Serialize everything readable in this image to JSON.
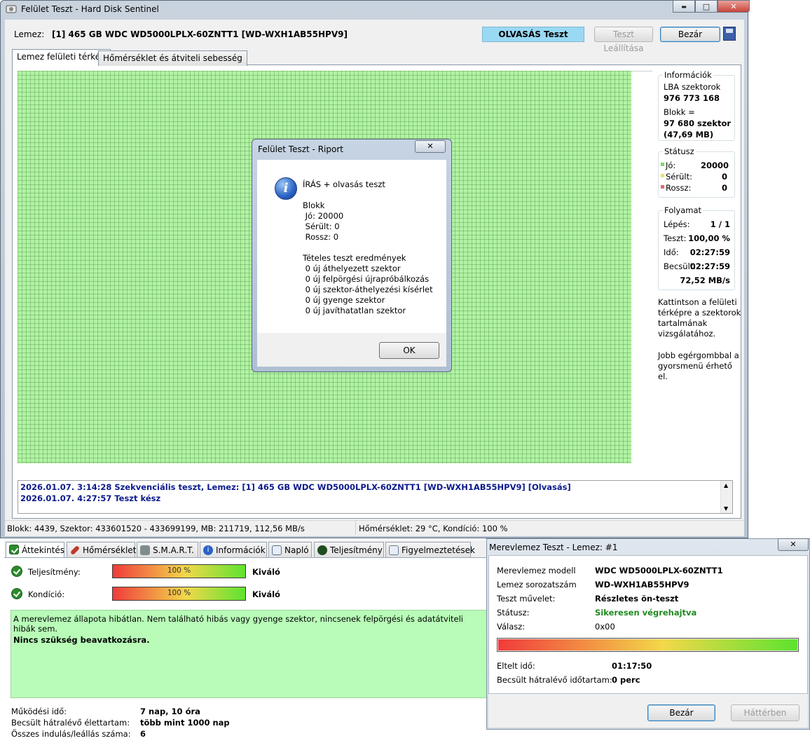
{
  "window": {
    "title": "Felület Teszt - Hard Disk Sentinel",
    "caption_minimize": "▬",
    "caption_maximize": "□",
    "caption_close": "✕"
  },
  "header": {
    "lemez_label": "Lemez:",
    "lemez_value": "[1] 465 GB  WDC WD5000LPLX-60ZNTT1 [WD-WXH1AB55HPV9]",
    "mode": "OLVASÁS Teszt",
    "stop_button": "Teszt Leállítása",
    "close_button": "Bezár"
  },
  "tabs": [
    {
      "label": "Lemez felületi térkép"
    },
    {
      "label": "Hőmérséklet és átviteli sebesség"
    }
  ],
  "info_box": {
    "title": "Információk",
    "lba_label": "LBA szektorok",
    "lba_value": "976 773 168",
    "block_label": "Blokk =",
    "block_value1": "97 680 szektor",
    "block_value2": "(47,69 MB)"
  },
  "status_box": {
    "title": "Státusz",
    "rows": [
      {
        "label": "Jó:",
        "value": "20000",
        "color": "#7fd86a"
      },
      {
        "label": "Sérült:",
        "value": "0",
        "color": "#e9e36a"
      },
      {
        "label": "Rossz:",
        "value": "0",
        "color": "#e36a6a"
      }
    ]
  },
  "progress_box": {
    "title": "Folyamat",
    "rows": [
      {
        "label": "Lépés:",
        "value": "1 / 1"
      },
      {
        "label": "Teszt:",
        "value": "100,00 %"
      },
      {
        "label": "Idő:",
        "value": "02:27:59"
      },
      {
        "label": "Becsült:",
        "value": "02:27:59"
      }
    ],
    "speed": "72,52 MB/s"
  },
  "hint1": [
    "Kattintson a felületi",
    "térképre a szektorok",
    "tartalmának",
    "vizsgálatához."
  ],
  "hint2": [
    "Jobb egérgombbal a",
    "gyorsmenü érhető",
    "el."
  ],
  "log": [
    "2026.01.07.  3:14:28   Szekvenciális teszt, Lemez: [1] 465 GB  WDC WD5000LPLX-60ZNTT1 [WD-WXH1AB55HPV9] [Olvasás]",
    "2026.01.07.  4:27:57   Teszt kész"
  ],
  "statusbar": {
    "left": "Blokk: 4439, Szektor: 433601520 - 433699199, MB: 211719, 112,56 MB/s",
    "right": "Hőmérséklet: 29  °C,  Kondíció: 100 %"
  },
  "report_dialog": {
    "title": "Felület Teszt - Riport",
    "close": "✕",
    "heading": "ÍRÁS + olvasás teszt",
    "block_title": "Blokk",
    "block_lines": [
      " Jó: 20000",
      " Sérült: 0",
      " Rossz: 0"
    ],
    "result_title": "Tételes teszt eredmények",
    "result_lines": [
      " 0 új áthelyezett szektor",
      " 0 új felpörgési újrapróbálkozás",
      " 0 új szektor-áthelyezési kísérlet",
      " 0 új gyenge szektor",
      " 0 új javíthatatlan szektor"
    ],
    "ok_button": "OK"
  },
  "overview": {
    "tabs": [
      {
        "label": "Áttekintés",
        "icon": "check-icon",
        "color": "#2d8a2d"
      },
      {
        "label": "Hőmérséklet",
        "icon": "thermometer-icon",
        "color": "#c0392b"
      },
      {
        "label": "S.M.A.R.T.",
        "icon": "chip-icon",
        "color": "#7f8c8d"
      },
      {
        "label": "Információk",
        "icon": "info-icon",
        "color": "#2a63c6"
      },
      {
        "label": "Napló",
        "icon": "document-icon",
        "color": "#5a6d8c"
      },
      {
        "label": "Teljesítmény",
        "icon": "gauge-icon",
        "color": "#1f4d1f"
      },
      {
        "label": "Figyelmeztetések",
        "icon": "alert-document-icon",
        "color": "#6b7a90"
      }
    ],
    "performance_label": "Teljesítmény:",
    "performance_percent": "100 %",
    "performance_value": 100,
    "performance_rating": "Kiváló",
    "condition_label": "Kondíció:",
    "condition_percent": "100 %",
    "condition_value": 100,
    "condition_rating": "Kiváló",
    "message": "A merevlemez állapota hibátlan. Nem található hibás vagy gyenge szektor, nincsenek felpörgési és adatátviteli hibák sem.",
    "message_bold": "Nincs szükség beavatkozásra.",
    "stats": [
      {
        "label": "Működési idő:",
        "value": "7 nap, 10 óra"
      },
      {
        "label": "Becsült hátralévő élettartam:",
        "value": "több mint 1000 nap"
      },
      {
        "label": "Összes indulás/leállás száma:",
        "value": "6"
      }
    ]
  },
  "hdd_test": {
    "title": "Merevlemez Teszt - Lemez: #1",
    "close": "✕",
    "rows": [
      {
        "label": "Merevlemez modell",
        "value": "WDC WD5000LPLX-60ZNTT1"
      },
      {
        "label": "Lemez sorozatszám",
        "value": "WD-WXH1AB55HPV9"
      },
      {
        "label": "Teszt művelet:",
        "value": "Részletes ön-teszt"
      },
      {
        "label": "Státusz:",
        "value": "Sikeresen végrehajtva"
      },
      {
        "label": "Válasz:",
        "value": "0x00"
      }
    ],
    "status_color": "#1f8a1f",
    "progress_value": 100,
    "elapsed_label": "Eltelt idő:",
    "elapsed_value": "01:17:50",
    "remaining_label": "Becsült hátralévő időtartam:",
    "remaining_value": "0 perc",
    "close_button": "Bezár",
    "background_button": "Háttérben"
  }
}
